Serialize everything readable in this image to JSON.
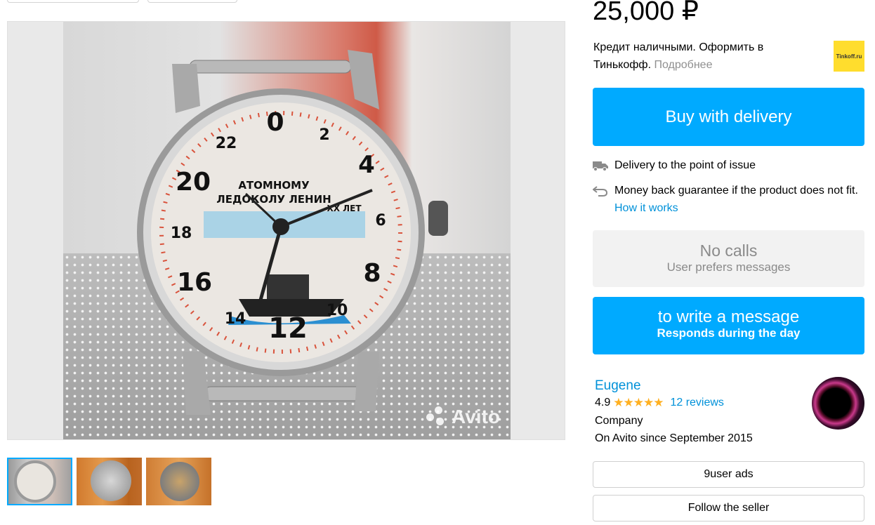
{
  "price": "25,000 ₽",
  "credit": {
    "text": "Кредит наличными. Оформить в Тинькофф.",
    "more_link": "Подробнее",
    "logo_text": "Tinkoff.ru"
  },
  "buttons": {
    "buy": "Buy with delivery",
    "write_title": "to write a message",
    "write_subtitle": "Responds during the day",
    "user_ads": "9user ads",
    "follow": "Follow the seller"
  },
  "delivery": {
    "text": "Delivery to the point of issue",
    "icon": "truck-icon"
  },
  "guarantee": {
    "text": "Money back guarantee if the product does not fit.",
    "link": "How it works",
    "icon": "return-arrow-icon"
  },
  "no_calls": {
    "title": "No calls",
    "subtitle": "User prefers messages"
  },
  "seller": {
    "name": "Eugene",
    "rating": "4.9",
    "stars": "★★★★★",
    "reviews": "12 reviews",
    "type": "Company",
    "since": "On Avito since September 2015"
  },
  "watermark": "Avito",
  "colors": {
    "accent": "#00aaff",
    "link": "#0091d9",
    "star": "#ffb021",
    "tinkoff": "#ffdd2d"
  }
}
